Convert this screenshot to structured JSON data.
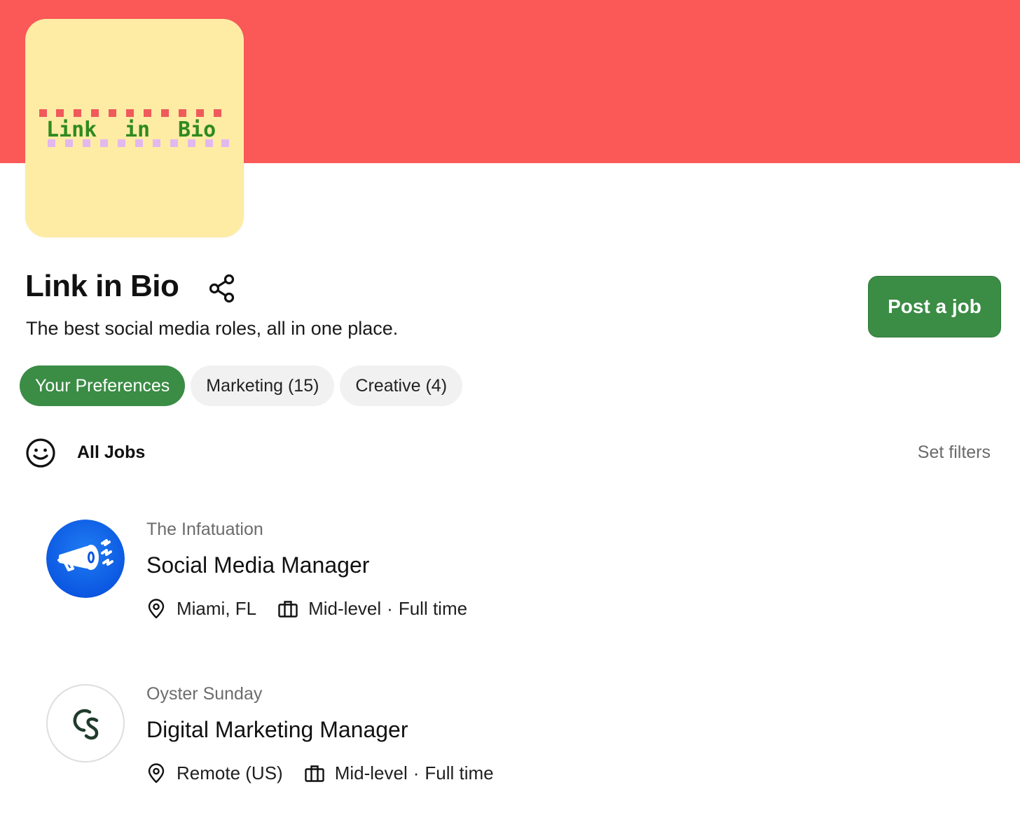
{
  "colors": {
    "banner": "#fb5858",
    "logo_background": "#feeca5",
    "accent_green": "#3b8c45",
    "chip_background": "#f1f1f1"
  },
  "brand": {
    "logo_text": [
      "Link",
      "in",
      "Bio"
    ]
  },
  "header": {
    "title": "Link in Bio",
    "tagline": "The best social media roles, all in one place.",
    "post_job_label": "Post a job",
    "share_icon": "share-icon"
  },
  "tabs": [
    {
      "label": "Your Preferences",
      "active": true
    },
    {
      "label": "Marketing (15)",
      "active": false
    },
    {
      "label": "Creative (4)",
      "active": false
    }
  ],
  "jobs_header": {
    "icon": "smile-icon",
    "label": "All Jobs",
    "filters_label": "Set filters"
  },
  "jobs": [
    {
      "company": "The Infatuation",
      "title": "Social Media Manager",
      "location": "Miami, FL",
      "level": "Mid-level",
      "separator": "·",
      "type": "Full time",
      "logo_icon": "megaphone-icon"
    },
    {
      "company": "Oyster Sunday",
      "title": "Digital Marketing Manager",
      "location": "Remote (US)",
      "level": "Mid-level",
      "separator": "·",
      "type": "Full time",
      "logo_icon": "os-monogram-icon"
    }
  ]
}
